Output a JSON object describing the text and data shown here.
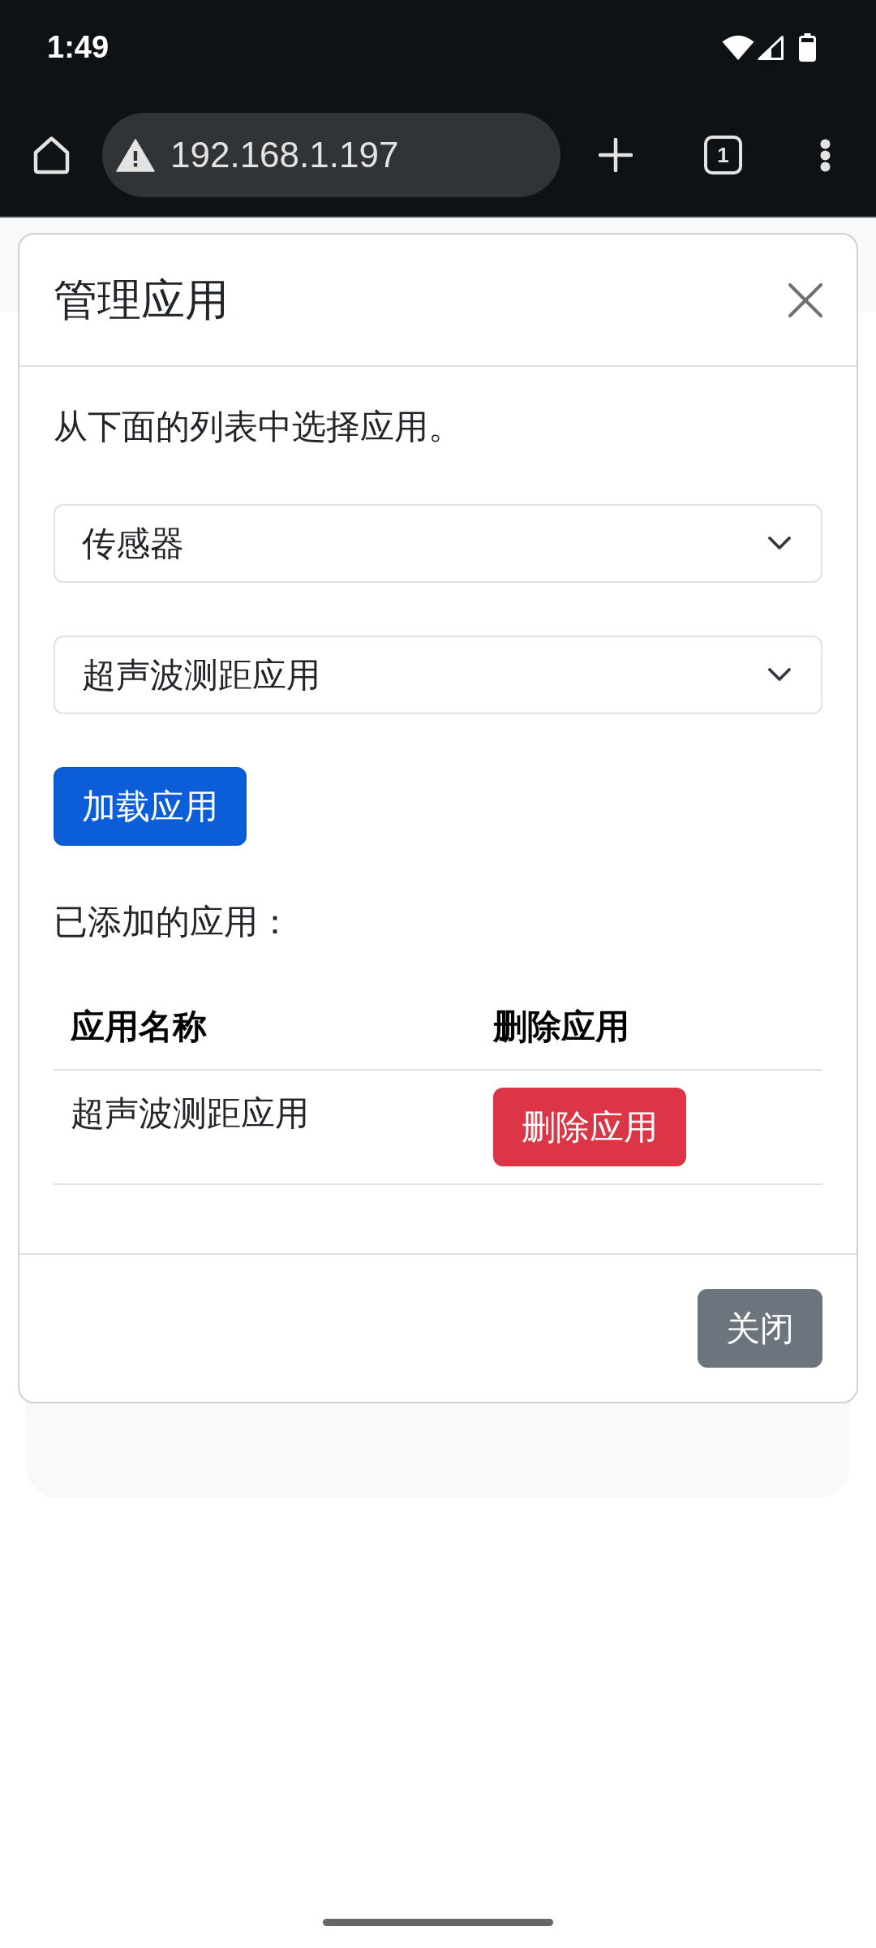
{
  "status_bar": {
    "time": "1:49"
  },
  "browser": {
    "url": "192.168.1.197",
    "tab_count": "1"
  },
  "modal": {
    "title": "管理应用",
    "intro": "从下面的列表中选择应用。",
    "selects": [
      {
        "value": "传感器"
      },
      {
        "value": "超声波测距应用"
      }
    ],
    "load_button": "加载应用",
    "added_label": "已添加的应用：",
    "table": {
      "columns": [
        "应用名称",
        "删除应用"
      ],
      "rows": [
        {
          "name": "超声波测距应用",
          "action": "删除应用"
        }
      ]
    },
    "footer_button": "关闭"
  }
}
